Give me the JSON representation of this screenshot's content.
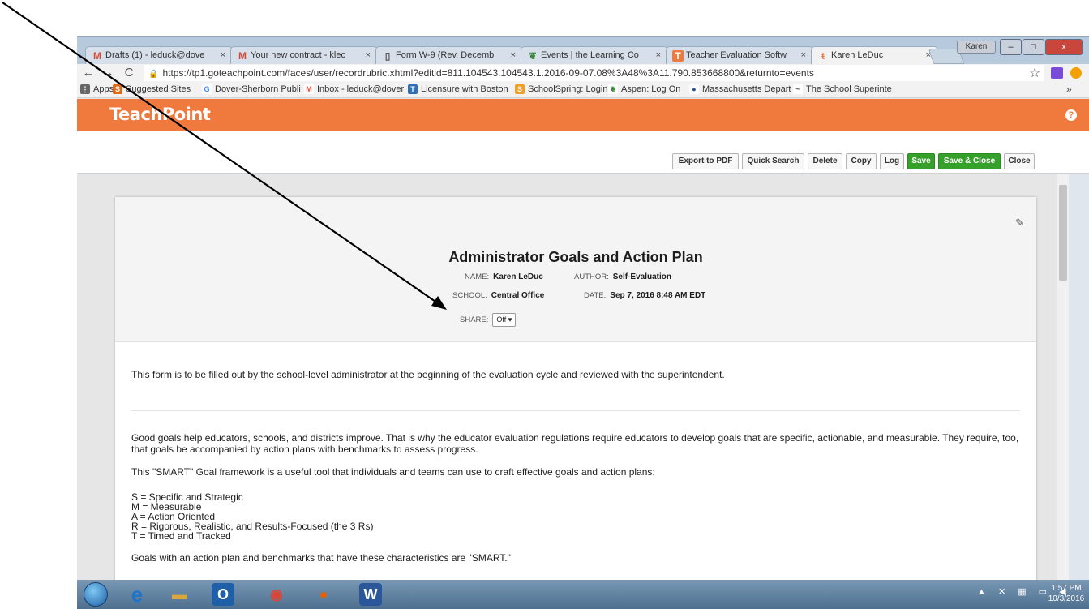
{
  "browser": {
    "tabs": [
      {
        "label": "Drafts (1) - leduck@dove",
        "icon": "gmail-icon",
        "glyph": "M",
        "color": "#d14836"
      },
      {
        "label": "Your new contract - klec",
        "icon": "gmail-icon",
        "glyph": "M",
        "color": "#d14836"
      },
      {
        "label": "Form W-9 (Rev. Decemb",
        "icon": "document-icon",
        "glyph": "▯",
        "color": "#555555"
      },
      {
        "label": "Events | the Learning Co",
        "icon": "leaf-icon",
        "glyph": "❦",
        "color": "#3a8a3a"
      },
      {
        "label": "Teacher Evaluation Softw",
        "icon": "teachpoint-icon",
        "glyph": "T",
        "color": "#f07a3e"
      },
      {
        "label": "Karen LeDuc",
        "icon": "teachpoint-icon",
        "glyph": "ŧ",
        "color": "#f07a3e"
      }
    ],
    "profile_name": "Karen",
    "tab_close_glyph": "×",
    "url": "https://tp1.goteachpoint.com/faces/user/recordrubric.xhtml?editid=811.104543.104543.1.2016-09-07.08%3A48%3A11.790.853668800&returnto=events",
    "nav": {
      "back": "←",
      "forward": "→",
      "reload": "C",
      "star": "☆",
      "lock": "🔒"
    },
    "window_buttons": {
      "minimize": "–",
      "maximize": "□",
      "close": "x"
    },
    "bookmarks": [
      {
        "label": "Apps",
        "icon": "apps-icon",
        "color": "#666666",
        "glyph": "⋮"
      },
      {
        "label": "Suggested Sites",
        "icon": "suggested-sites-icon",
        "color": "#e06a1a",
        "glyph": "S"
      },
      {
        "label": "Dover-Sherborn Publi",
        "icon": "google-icon",
        "color": "#4285f4",
        "glyph": "G"
      },
      {
        "label": "Inbox - leduck@dover",
        "icon": "gmail-icon",
        "color": "#d14836",
        "glyph": "M"
      },
      {
        "label": "Licensure with Boston",
        "icon": "tec-icon",
        "color": "#2e6fb5",
        "glyph": "T"
      },
      {
        "label": "SchoolSpring: Login",
        "icon": "schoolspring-icon",
        "color": "#f0a020",
        "glyph": "S"
      },
      {
        "label": "Aspen: Log On",
        "icon": "aspen-leaf-icon",
        "color": "#3a8a3a",
        "glyph": "❦"
      },
      {
        "label": "Massachusetts Depart",
        "icon": "ma-seal-icon",
        "color": "#2a4f8f",
        "glyph": "●"
      },
      {
        "label": "The School Superinte",
        "icon": "mass-supt-icon",
        "color": "#555555",
        "glyph": "~"
      }
    ],
    "more_bookmarks": "»"
  },
  "app": {
    "logo": "TeachPoint",
    "help": "?",
    "actions": [
      "Export to PDF",
      "Quick Search",
      "Delete",
      "Copy",
      "Log",
      "Save",
      "Save & Close",
      "Close"
    ],
    "accent_color": "#f07a3e",
    "save_color": "#35a02a"
  },
  "form": {
    "title": "Administrator Goals and Action Plan",
    "name_label": "NAME:",
    "name_value": "Karen LeDuc",
    "author_label": "AUTHOR:",
    "author_value": "Self-Evaluation",
    "school_label": "SCHOOL:",
    "school_value": "Central Office",
    "date_label": "DATE:",
    "date_value": "Sep 7, 2016 8:48 AM EDT",
    "share_label": "SHARE:",
    "share_value": "Off ▾",
    "intro": "This form is to be filled out by the school-level administrator at the beginning of the evaluation cycle and reviewed with the superintendent.",
    "p1": "Good goals help educators, schools, and districts improve. That is why the educator evaluation regulations require educators to develop goals that are specific, actionable, and measurable. They require, too, that goals be accompanied by action plans with benchmarks to assess progress.",
    "p2": "This \"SMART\" Goal framework is a useful tool that individuals and teams can use to craft effective goals and action plans:",
    "smart": [
      "S = Specific and Strategic",
      "M = Measurable",
      "A = Action Oriented",
      "R = Rigorous, Realistic, and Results-Focused (the 3 Rs)",
      "T = Timed and Tracked"
    ],
    "p3": "Goals with an action plan and benchmarks that have these characteristics are \"SMART.\""
  },
  "taskbar": {
    "clock_time": "1:57 PM",
    "clock_date": "10/3/2016",
    "apps": [
      {
        "icon": "internet-explorer-icon",
        "glyph": "e",
        "color": "#1f74c8"
      },
      {
        "icon": "file-explorer-icon",
        "glyph": "▬",
        "color": "#d8a83a"
      },
      {
        "icon": "outlook-icon",
        "glyph": "O",
        "color": "#1f5fa8"
      },
      {
        "icon": "chrome-icon",
        "glyph": "◉",
        "color": "#db4437"
      },
      {
        "icon": "firefox-icon",
        "glyph": "●",
        "color": "#e66000"
      },
      {
        "icon": "word-icon",
        "glyph": "W",
        "color": "#2b579a"
      }
    ],
    "tray": "▲ ✕ ▦ ▭ ◀"
  }
}
